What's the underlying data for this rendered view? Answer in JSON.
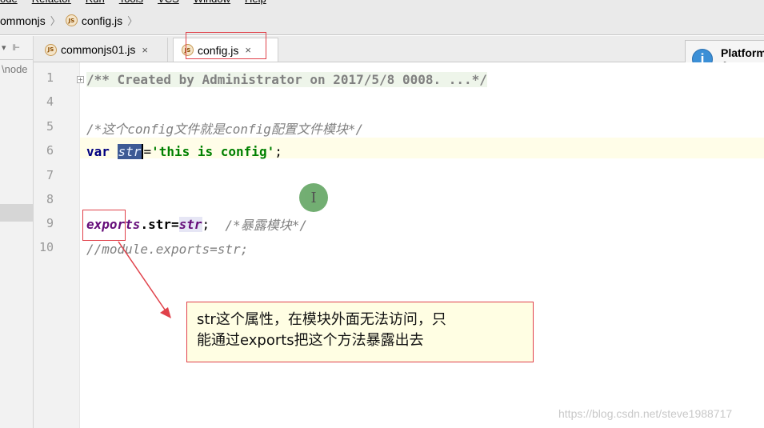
{
  "menu": [
    "ode",
    "Refactor",
    "Run",
    "Tools",
    "VCS",
    "Window",
    "Help"
  ],
  "breadcrumb": {
    "items": [
      "ommonjs",
      "config.js"
    ],
    "separator": "〉"
  },
  "project": {
    "path": "\\node"
  },
  "tabs": [
    {
      "label": "commonjs01.js",
      "close": "×",
      "active": false
    },
    {
      "label": "config.js",
      "close": "×",
      "active": true
    }
  ],
  "notification": {
    "line1": "Platform",
    "line2": "A new v",
    "icon": "i"
  },
  "editor": {
    "line_numbers": [
      "1",
      "4",
      "5",
      "6",
      "7",
      "8",
      "9",
      "10"
    ],
    "fold_marker": "+",
    "line1": "/** Created by Administrator on 2017/5/8 0008. ...*/",
    "line5": "/*这个config文件就是config配置文件模块*/",
    "line6": {
      "kw": "var ",
      "var": "str",
      "op": "=",
      "str": "'this is config'",
      "end": ";"
    },
    "line9": {
      "obj": "exports",
      "prop": ".str=",
      "val": "str",
      "end": ";  ",
      "comment": "/*暴露模块*/"
    },
    "line10": "//module.exports=str;"
  },
  "cursor_glyph": "I",
  "callout": {
    "line1": "str这个属性，在模块外面无法访问，只",
    "line2": "能通过exports把这个方法暴露出去"
  },
  "watermark": "https://blog.csdn.net/steve1988717",
  "colors": {
    "highlight_border": "#e0414a",
    "callout_bg": "#fffee3",
    "keyword": "#000080",
    "string": "#008000"
  }
}
